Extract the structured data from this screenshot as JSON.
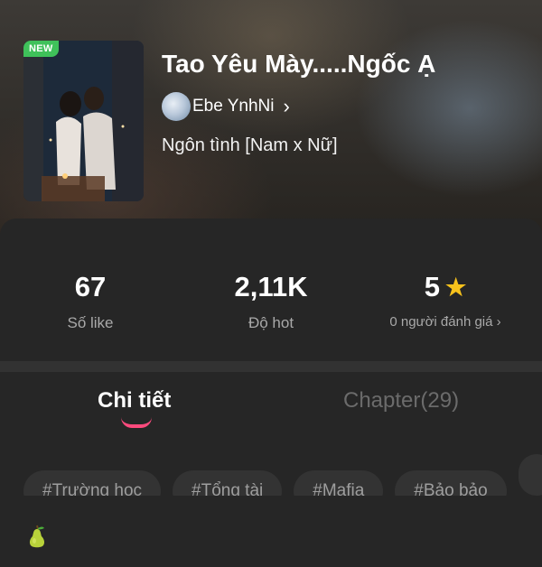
{
  "story": {
    "new_badge": "NEW",
    "title": "Tao Yêu Mày.....Ngốc Ạ",
    "author": "Ebe YnhNi",
    "genre": "Ngôn tình [Nam x Nữ]"
  },
  "stats": {
    "likes": {
      "value": "67",
      "label": "Số like"
    },
    "hot": {
      "value": "2,11K",
      "label": "Độ hot"
    },
    "rating": {
      "value": "5",
      "label": "0 người đánh giá ›"
    }
  },
  "tabs": {
    "detail": "Chi tiết",
    "chapter": "Chapter(29)"
  },
  "tags": [
    "#Trường học",
    "#Tổng tài",
    "#Mafia",
    "#Bảo bảo"
  ],
  "icons": {
    "author_chevron": "chevron-right-icon",
    "rating_star": "star-icon",
    "emoji": "pear-icon"
  },
  "colors": {
    "accent": "#ff4a7d",
    "star": "#f7c21c",
    "new_badge": "#3fc15a"
  }
}
